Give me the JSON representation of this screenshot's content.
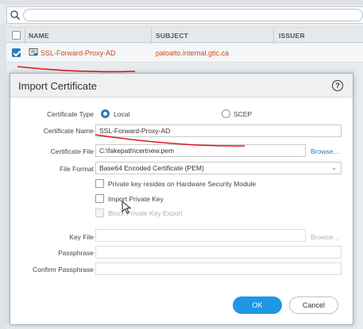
{
  "table": {
    "columns": [
      "NAME",
      "SUBJECT",
      "ISSUER"
    ],
    "rows": [
      {
        "name": "SSL-Forward-Proxy-AD",
        "subject": "paloalto.internal.gtic.ca",
        "checked": true
      }
    ]
  },
  "dialog": {
    "title": "Import Certificate",
    "help": "?",
    "fields": {
      "certificate_type_label": "Certificate Type",
      "type_local": "Local",
      "type_scep": "SCEP",
      "certificate_name_label": "Certificate Name",
      "certificate_name_value": "SSL-Forward-Proxy-AD",
      "certificate_file_label": "Certificate File",
      "certificate_file_value": "C:\\fakepath\\certnew.pem",
      "browse": "Browse...",
      "file_format_label": "File Format",
      "file_format_value": "Base64 Encoded Certificate (PEM)",
      "hsm_label": "Private key resides on Hardware Security Module",
      "import_key_label": "Import Private Key",
      "block_export_label": "Block Private Key Export",
      "key_file_label": "Key File",
      "key_file_browse": "Browse...",
      "passphrase_label": "Passphrase",
      "confirm_passphrase_label": "Confirm Passphrase"
    },
    "buttons": {
      "ok": "OK",
      "cancel": "Cancel"
    }
  },
  "colors": {
    "accent": "#1e97e5",
    "link": "#d24a1f",
    "annotation": "#e0141a"
  }
}
